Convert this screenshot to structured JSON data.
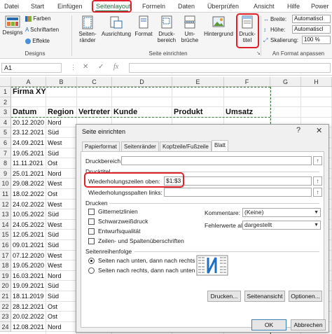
{
  "tabs": [
    "Datei",
    "Start",
    "Einfügen",
    "Seitenlayout",
    "Formeln",
    "Daten",
    "Überprüfen",
    "Ansicht",
    "Hilfe",
    "Power"
  ],
  "ribbon": {
    "designs_label": "Designs",
    "farben": "Farben",
    "schriftarten": "Schriftarten",
    "effekte": "Effekte",
    "group_designs": "Designs",
    "seitenraender": "Seiten-\nränder",
    "ausrichtung": "Ausrichtung",
    "format": "Format",
    "druckbereich": "Druck-\nbereich",
    "umbrueche": "Um-\nbrüche",
    "hintergrund": "Hintergrund",
    "drucktitel": "Druck-\ntitel",
    "group_seite": "Seite einrichten",
    "breite_label": "Breite:",
    "breite_value": "Automatiscl",
    "hoehe_label": "Höhe:",
    "hoehe_value": "Automatiscl",
    "skalierung_label": "Skalierung:",
    "skalierung_value": "100 %",
    "group_format": "An Format anpassen"
  },
  "formula_bar": {
    "cell_ref": "A1",
    "fx": "fx"
  },
  "columns": [
    "A",
    "B",
    "C",
    "D",
    "E",
    "F",
    "G",
    "H"
  ],
  "rows": [
    {
      "n": "1",
      "cells": [
        "Firma XY",
        "",
        "",
        "",
        "",
        ""
      ]
    },
    {
      "n": "2",
      "cells": [
        "",
        "",
        "",
        "",
        "",
        ""
      ]
    },
    {
      "n": "3",
      "cells": [
        "Datum",
        "Region",
        "Vertreter",
        "Kunde",
        "Produkt",
        "Umsatz"
      ]
    },
    {
      "n": "4",
      "cells": [
        "20.12.2020",
        "Nord",
        "",
        "",
        "",
        ""
      ]
    },
    {
      "n": "5",
      "cells": [
        "23.12.2021",
        "Süd",
        "",
        "",
        "",
        ""
      ]
    },
    {
      "n": "6",
      "cells": [
        "24.09.2021",
        "West",
        "",
        "",
        "",
        ""
      ]
    },
    {
      "n": "7",
      "cells": [
        "19.05.2021",
        "Süd",
        "",
        "",
        "",
        ""
      ]
    },
    {
      "n": "8",
      "cells": [
        "11.11.2021",
        "Ost",
        "",
        "",
        "",
        ""
      ]
    },
    {
      "n": "9",
      "cells": [
        "25.01.2021",
        "Nord",
        "",
        "",
        "",
        ""
      ]
    },
    {
      "n": "10",
      "cells": [
        "29.08.2022",
        "West",
        "",
        "",
        "",
        ""
      ]
    },
    {
      "n": "11",
      "cells": [
        "18.02.2022",
        "Ost",
        "",
        "",
        "",
        ""
      ]
    },
    {
      "n": "12",
      "cells": [
        "24.02.2022",
        "West",
        "",
        "",
        "",
        ""
      ]
    },
    {
      "n": "13",
      "cells": [
        "10.05.2022",
        "Süd",
        "",
        "",
        "",
        ""
      ]
    },
    {
      "n": "14",
      "cells": [
        "24.05.2022",
        "West",
        "",
        "",
        "",
        ""
      ]
    },
    {
      "n": "15",
      "cells": [
        "12.05.2021",
        "Süd",
        "",
        "",
        "",
        ""
      ]
    },
    {
      "n": "16",
      "cells": [
        "09.01.2021",
        "Süd",
        "",
        "",
        "",
        ""
      ]
    },
    {
      "n": "17",
      "cells": [
        "07.12.2020",
        "West",
        "",
        "",
        "",
        ""
      ]
    },
    {
      "n": "18",
      "cells": [
        "19.05.2020",
        "West",
        "",
        "",
        "",
        ""
      ]
    },
    {
      "n": "19",
      "cells": [
        "16.03.2021",
        "Nord",
        "",
        "",
        "",
        ""
      ]
    },
    {
      "n": "20",
      "cells": [
        "19.09.2021",
        "Süd",
        "",
        "",
        "",
        ""
      ]
    },
    {
      "n": "21",
      "cells": [
        "18.11.2019",
        "Süd",
        "",
        "",
        "",
        ""
      ]
    },
    {
      "n": "22",
      "cells": [
        "28.12.2021",
        "Ost",
        "",
        "",
        "",
        ""
      ]
    },
    {
      "n": "23",
      "cells": [
        "20.02.2022",
        "Ost",
        "",
        "",
        "",
        ""
      ]
    },
    {
      "n": "24",
      "cells": [
        "12.08.2021",
        "Nord",
        "",
        "",
        "",
        ""
      ]
    }
  ],
  "dialog": {
    "title": "Seite einrichten",
    "help": "?",
    "close": "✕",
    "tabs": [
      "Papierformat",
      "Seitenränder",
      "Kopfzeile/Fußzeile",
      "Blatt"
    ],
    "druckbereich_label": "Druckbereich:",
    "drucktitel_section": "Drucktitel",
    "wdh_zeilen_label": "Wiederholungszeilen oben:",
    "wdh_zeilen_value": "$1:$3",
    "wdh_spalten_label": "Wiederholungsspalten links:",
    "drucken_section": "Drucken",
    "gitternetz": "Gitternetzlinien",
    "schwarzweiss": "Schwarzweißdruck",
    "entwurf": "Entwurfsqualität",
    "zeilen_spalten": "Zeilen- und Spaltenüberschriften",
    "kommentare_label": "Kommentare:",
    "kommentare_value": "(Keine)",
    "fehlerwerte_label": "Fehlerwerte als:",
    "fehlerwerte_value": "dargestellt",
    "reihenfolge_section": "Seitenreihenfolge",
    "order1": "Seiten nach unten, dann nach rechts",
    "order2": "Seiten nach rechts, dann nach unten",
    "btn_drucken": "Drucken...",
    "btn_seitenansicht": "Seitenansicht",
    "btn_optionen": "Optionen...",
    "btn_ok": "OK",
    "btn_abbrechen": "Abbrechen"
  }
}
